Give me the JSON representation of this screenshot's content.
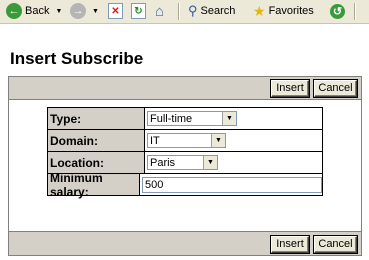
{
  "browser_toolbar": {
    "back_label": "Back",
    "search_label": "Search",
    "favorites_label": "Favorites"
  },
  "page": {
    "title": "Insert Subscribe"
  },
  "form": {
    "insert_label": "Insert",
    "cancel_label": "Cancel",
    "fields": {
      "type": {
        "label": "Type:",
        "value": "Full-time"
      },
      "domain": {
        "label": "Domain:",
        "value": "IT"
      },
      "location": {
        "label": "Location:",
        "value": "Paris"
      },
      "minimum_salary": {
        "label": "Minimum salary:",
        "value": "500"
      }
    }
  }
}
